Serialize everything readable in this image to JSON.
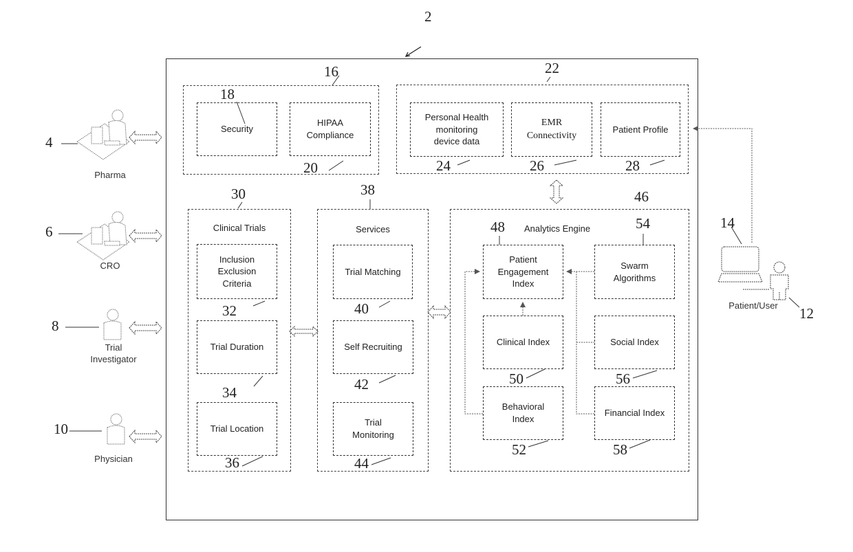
{
  "system": {
    "ref": "2"
  },
  "actors": [
    {
      "id": "pharma",
      "label": "Pharma",
      "ref": "4"
    },
    {
      "id": "cro",
      "label": "CRO",
      "ref": "6"
    },
    {
      "id": "trial-investigator",
      "label": "Trial\nInvestigator",
      "ref": "8"
    },
    {
      "id": "physician",
      "label": "Physician",
      "ref": "10"
    },
    {
      "id": "patient-user",
      "label": "Patient/User",
      "ref": "12"
    },
    {
      "id": "computer",
      "label": "",
      "ref": "14"
    }
  ],
  "compliance_group": {
    "ref": "16",
    "items": [
      {
        "label": "Security",
        "ref": "18"
      },
      {
        "label": "HIPAA\nCompliance",
        "ref": "20"
      }
    ]
  },
  "data_group": {
    "ref": "22",
    "items": [
      {
        "label": "Personal Health\nmonitoring\ndevice data",
        "ref": "24"
      },
      {
        "label": "EMR\nConnectivity",
        "ref": "26"
      },
      {
        "label": "Patient Profile",
        "ref": "28"
      }
    ]
  },
  "clinical_trials": {
    "title": "Clinical Trials",
    "ref": "30",
    "items": [
      {
        "label": "Inclusion\nExclusion\nCriteria",
        "ref": "32"
      },
      {
        "label": "Trial Duration",
        "ref": "34"
      },
      {
        "label": "Trial Location",
        "ref": "36"
      }
    ]
  },
  "services": {
    "title": "Services",
    "ref": "38",
    "items": [
      {
        "label": "Trial Matching",
        "ref": "40"
      },
      {
        "label": "Self Recruiting",
        "ref": "42"
      },
      {
        "label": "Trial\nMonitoring",
        "ref": "44"
      }
    ]
  },
  "analytics_engine": {
    "title": "Analytics Engine",
    "ref": "46",
    "items": [
      {
        "label": "Patient\nEngagement\nIndex",
        "ref": "48"
      },
      {
        "label": "Clinical Index",
        "ref": "50"
      },
      {
        "label": "Behavioral\nIndex",
        "ref": "52"
      },
      {
        "label": "Swarm\nAlgorithms",
        "ref": "54"
      },
      {
        "label": "Social Index",
        "ref": "56"
      },
      {
        "label": "Financial Index",
        "ref": "58"
      }
    ]
  }
}
